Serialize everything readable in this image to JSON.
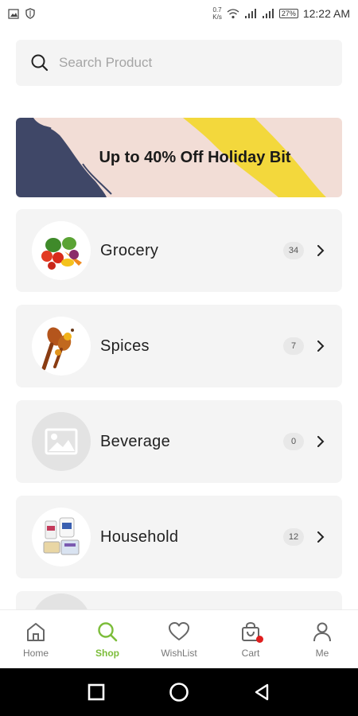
{
  "status_bar": {
    "speed_value": "0.7",
    "speed_unit": "K/s",
    "battery": "27%",
    "time": "12:22 AM"
  },
  "search": {
    "placeholder": "Search Product"
  },
  "banner": {
    "text": "Up to 40% Off Holiday Bit"
  },
  "categories": [
    {
      "name": "Grocery",
      "count": "34",
      "image": "vegetables-image"
    },
    {
      "name": "Spices",
      "count": "7",
      "image": "spices-image"
    },
    {
      "name": "Beverage",
      "count": "0",
      "image": "placeholder-image-icon"
    },
    {
      "name": "Household",
      "count": "12",
      "image": "household-products-image"
    }
  ],
  "bottom_nav": {
    "items": [
      {
        "label": "Home",
        "icon": "home-icon",
        "active": false
      },
      {
        "label": "Shop",
        "icon": "search-icon",
        "active": true
      },
      {
        "label": "WishList",
        "icon": "heart-icon",
        "active": false
      },
      {
        "label": "Cart",
        "icon": "cart-icon",
        "active": false
      },
      {
        "label": "Me",
        "icon": "user-icon",
        "active": false
      }
    ]
  },
  "colors": {
    "accent": "#7cbd3a",
    "banner_bg": "#f2ddd6",
    "banner_navy": "#3f4767",
    "banner_yellow": "#f3d83c",
    "cart_badge": "#e01e1e"
  }
}
